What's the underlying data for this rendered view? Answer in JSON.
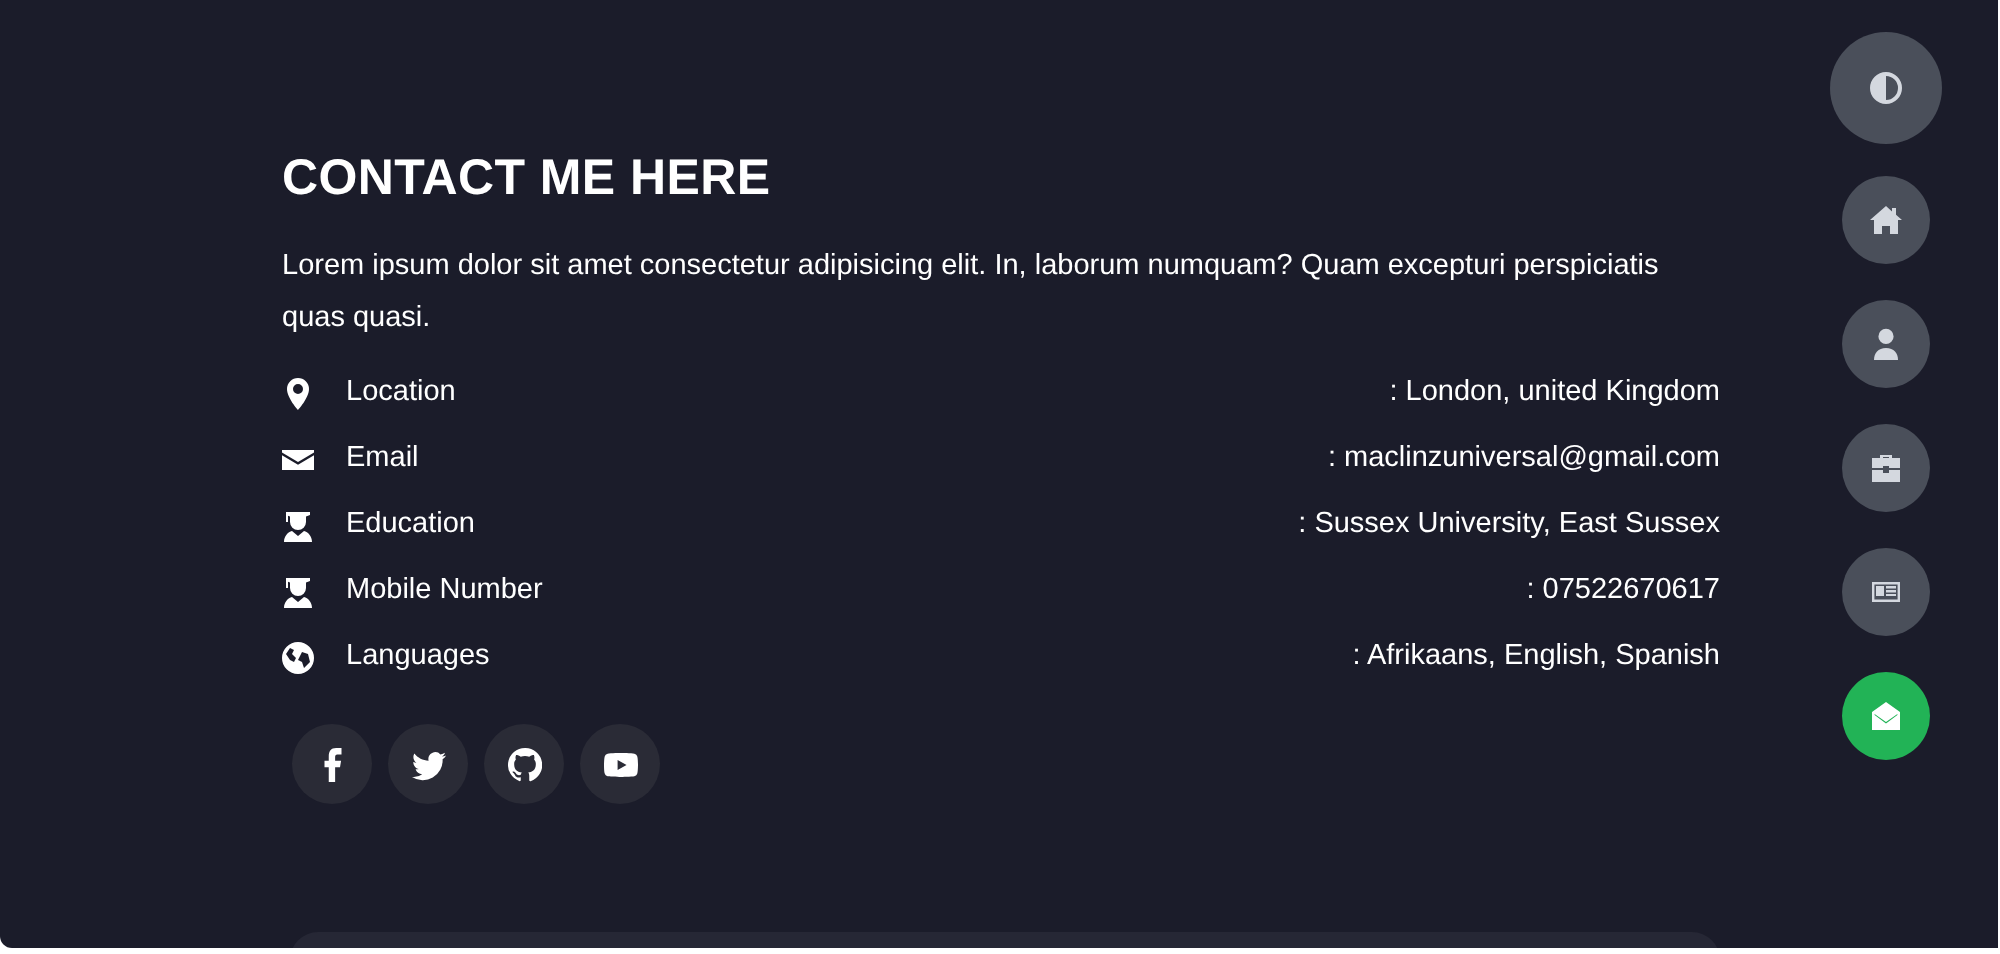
{
  "contact": {
    "title": "CONTACT ME HERE",
    "intro": "Lorem ipsum dolor sit amet consectetur adipisicing elit. In, laborum numquam? Quam excepturi perspiciatis quas quasi.",
    "items": [
      {
        "label": "Location",
        "value": ": London, united Kingdom"
      },
      {
        "label": "Email",
        "value": ": maclinzuniversal@gmail.com"
      },
      {
        "label": "Education",
        "value": ": Sussex University, East Sussex"
      },
      {
        "label": "Mobile Number",
        "value": ": 07522670617"
      },
      {
        "label": "Languages",
        "value": ": Afrikaans, English, Spanish"
      }
    ]
  },
  "side_nav": [
    {
      "kind": "theme",
      "selected": false
    },
    {
      "kind": "link",
      "selected": false
    },
    {
      "kind": "link",
      "selected": false
    },
    {
      "kind": "link",
      "selected": false
    },
    {
      "kind": "link",
      "selected": false
    },
    {
      "kind": "link",
      "selected": true
    }
  ]
}
